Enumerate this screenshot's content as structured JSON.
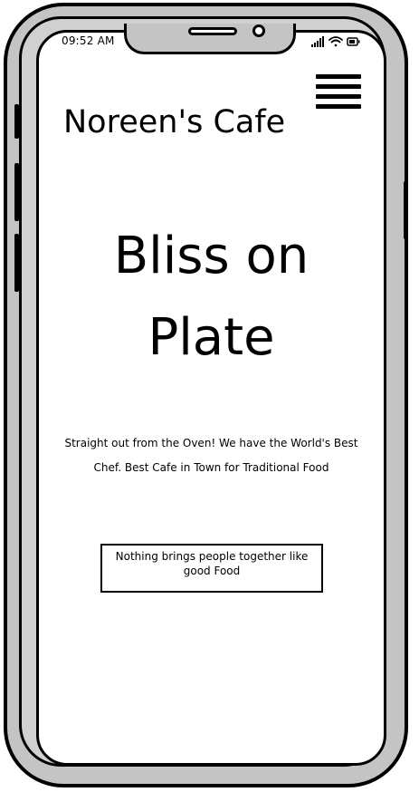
{
  "status_bar": {
    "time": "09:52 AM"
  },
  "header": {
    "brand": "Noreen's Cafe",
    "menu_icon": "hamburger-menu-icon"
  },
  "hero": {
    "line1": "Bliss on",
    "line2": "Plate"
  },
  "tagline": {
    "line1": "Straight out from the Oven! We have the World's Best",
    "line2": "Chef. Best Cafe in Town for Traditional Food"
  },
  "quote": {
    "line1": "Nothing brings people together like",
    "line2": "good Food"
  },
  "icons": {
    "signal": "signal-icon",
    "wifi": "wifi-icon",
    "battery": "battery-icon"
  },
  "colors": {
    "frame": "#c4c4c4",
    "outline": "#000000",
    "screen": "#ffffff"
  }
}
